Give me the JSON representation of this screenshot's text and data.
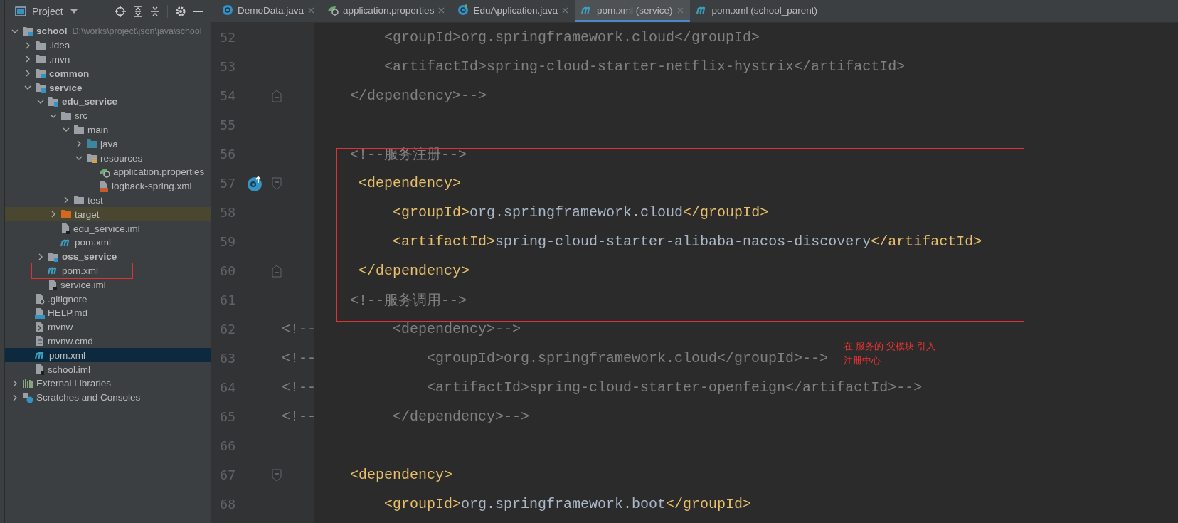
{
  "sidebar": {
    "title": "Project",
    "tree": [
      {
        "label": "school",
        "kind": "module",
        "bold": true,
        "path": "D:\\works\\project\\json\\java\\school",
        "expanded": true,
        "selected": false,
        "boxed": false,
        "children": [
          {
            "label": ".idea",
            "kind": "folder",
            "bold": false,
            "expanded": false,
            "selected": false,
            "boxed": false
          },
          {
            "label": ".mvn",
            "kind": "folder",
            "bold": false,
            "expanded": false,
            "selected": false,
            "boxed": false
          },
          {
            "label": "common",
            "kind": "module",
            "bold": true,
            "expanded": false,
            "selected": false,
            "boxed": false
          },
          {
            "label": "service",
            "kind": "module",
            "bold": true,
            "expanded": true,
            "selected": false,
            "boxed": false,
            "children": [
              {
                "label": "edu_service",
                "kind": "module",
                "bold": true,
                "expanded": true,
                "selected": false,
                "boxed": false,
                "children": [
                  {
                    "label": "src",
                    "kind": "folder",
                    "bold": false,
                    "expanded": true,
                    "selected": false,
                    "boxed": false,
                    "children": [
                      {
                        "label": "main",
                        "kind": "folder",
                        "bold": false,
                        "expanded": true,
                        "selected": false,
                        "boxed": false,
                        "children": [
                          {
                            "label": "java",
                            "kind": "source",
                            "bold": false,
                            "expanded": false,
                            "selected": false,
                            "boxed": false
                          },
                          {
                            "label": "resources",
                            "kind": "resources",
                            "bold": false,
                            "expanded": true,
                            "selected": false,
                            "boxed": false,
                            "children": [
                              {
                                "label": "application.properties",
                                "kind": "spring",
                                "bold": false,
                                "selected": false,
                                "boxed": false
                              },
                              {
                                "label": "logback-spring.xml",
                                "kind": "xml",
                                "bold": false,
                                "selected": false,
                                "boxed": false
                              }
                            ]
                          }
                        ]
                      },
                      {
                        "label": "test",
                        "kind": "folder",
                        "bold": false,
                        "expanded": false,
                        "selected": false,
                        "boxed": false
                      }
                    ]
                  },
                  {
                    "label": "target",
                    "kind": "excluded",
                    "bold": false,
                    "expanded": false,
                    "selected": false,
                    "boxed": false
                  },
                  {
                    "label": "edu_service.iml",
                    "kind": "iml",
                    "bold": false,
                    "selected": false,
                    "boxed": false
                  },
                  {
                    "label": "pom.xml",
                    "kind": "maven",
                    "bold": false,
                    "selected": false,
                    "boxed": false
                  }
                ]
              },
              {
                "label": "oss_service",
                "kind": "module",
                "bold": true,
                "expanded": false,
                "selected": false,
                "boxed": false
              },
              {
                "label": "pom.xml",
                "kind": "maven",
                "bold": false,
                "selected": false,
                "boxed": true
              },
              {
                "label": "service.iml",
                "kind": "iml",
                "bold": false,
                "selected": false,
                "boxed": false
              }
            ]
          },
          {
            "label": ".gitignore",
            "kind": "ignore",
            "bold": false,
            "selected": false,
            "boxed": false
          },
          {
            "label": "HELP.md",
            "kind": "md",
            "bold": false,
            "selected": false,
            "boxed": false
          },
          {
            "label": "mvnw",
            "kind": "script",
            "bold": false,
            "selected": false,
            "boxed": false
          },
          {
            "label": "mvnw.cmd",
            "kind": "text",
            "bold": false,
            "selected": false,
            "boxed": false
          },
          {
            "label": "pom.xml",
            "kind": "maven",
            "bold": false,
            "selected": true,
            "boxed": false
          },
          {
            "label": "school.iml",
            "kind": "iml",
            "bold": false,
            "selected": false,
            "boxed": false
          }
        ]
      },
      {
        "label": "External Libraries",
        "kind": "libs",
        "bold": false,
        "expanded": false,
        "selected": false,
        "boxed": false
      },
      {
        "label": "Scratches and Consoles",
        "kind": "scratches",
        "bold": false,
        "expanded": false,
        "selected": false,
        "boxed": false
      }
    ]
  },
  "tabs": [
    {
      "label": "DemoData.java",
      "kind": "java",
      "selected": false,
      "closable": true
    },
    {
      "label": "application.properties",
      "kind": "spring",
      "selected": false,
      "closable": true
    },
    {
      "label": "EduApplication.java",
      "kind": "boot",
      "selected": false,
      "closable": true
    },
    {
      "label": "pom.xml (service)",
      "kind": "maven",
      "selected": true,
      "closable": true
    },
    {
      "label": "pom.xml (school_parent)",
      "kind": "maven",
      "selected": false,
      "closable": false
    }
  ],
  "editor": {
    "lines": [
      {
        "number": "52",
        "boxed": false,
        "fold_start": false,
        "fold_end": false,
        "implemented": false,
        "segments": [
          {
            "kind": "comment",
            "text": "            <groupId>org.springframework.cloud</groupId>"
          }
        ]
      },
      {
        "number": "53",
        "boxed": false,
        "fold_start": false,
        "fold_end": false,
        "implemented": false,
        "segments": [
          {
            "kind": "comment",
            "text": "            <artifactId>spring-cloud-starter-netflix-hystrix</artifactId>"
          }
        ]
      },
      {
        "number": "54",
        "boxed": false,
        "fold_start": false,
        "fold_end": true,
        "implemented": false,
        "segments": [
          {
            "kind": "comment",
            "text": "        </dependency>-->"
          }
        ]
      },
      {
        "number": "55",
        "boxed": false,
        "fold_start": false,
        "fold_end": false,
        "implemented": false
      },
      {
        "number": "56",
        "boxed": true,
        "fold_start": false,
        "fold_end": false,
        "implemented": false,
        "segments": [
          {
            "kind": "comment",
            "text": "        <!--服务注册-->"
          }
        ]
      },
      {
        "number": "57",
        "boxed": true,
        "fold_start": true,
        "fold_end": false,
        "implemented": true,
        "segments": [
          {
            "kind": "tag",
            "text": "         <dependency>"
          }
        ]
      },
      {
        "number": "58",
        "boxed": true,
        "fold_start": false,
        "fold_end": false,
        "implemented": false,
        "segments": [
          {
            "kind": "tag",
            "text": "             <groupId>"
          },
          {
            "kind": "text",
            "text": "org.springframework.cloud"
          },
          {
            "kind": "tag",
            "text": "</groupId>"
          }
        ]
      },
      {
        "number": "59",
        "boxed": true,
        "fold_start": false,
        "fold_end": false,
        "implemented": false,
        "segments": [
          {
            "kind": "tag",
            "text": "             <artifactId>"
          },
          {
            "kind": "text",
            "text": "spring-cloud-starter-alibaba-nacos-discovery"
          },
          {
            "kind": "tag",
            "text": "</artifactId>"
          }
        ]
      },
      {
        "number": "60",
        "boxed": true,
        "fold_start": false,
        "fold_end": true,
        "implemented": false,
        "segments": [
          {
            "kind": "tag",
            "text": "         </dependency>"
          }
        ]
      },
      {
        "number": "61",
        "boxed": true,
        "fold_start": false,
        "fold_end": false,
        "implemented": false,
        "segments": [
          {
            "kind": "comment",
            "text": "        <!--服务调用-->"
          }
        ]
      },
      {
        "number": "62",
        "boxed": false,
        "fold_start": false,
        "fold_end": false,
        "implemented": false,
        "segments": [
          {
            "kind": "comment",
            "text": "<!--         <dependency>-->"
          }
        ]
      },
      {
        "number": "63",
        "boxed": false,
        "fold_start": false,
        "fold_end": false,
        "implemented": false,
        "segments": [
          {
            "kind": "comment",
            "text": "<!--             <groupId>org.springframework.cloud</groupId>-->"
          }
        ]
      },
      {
        "number": "64",
        "boxed": false,
        "fold_start": false,
        "fold_end": false,
        "implemented": false,
        "segments": [
          {
            "kind": "comment",
            "text": "<!--             <artifactId>spring-cloud-starter-openfeign</artifactId>-->"
          }
        ]
      },
      {
        "number": "65",
        "boxed": false,
        "fold_start": false,
        "fold_end": false,
        "implemented": false,
        "segments": [
          {
            "kind": "comment",
            "text": "<!--         </dependency>-->"
          }
        ]
      },
      {
        "number": "66",
        "boxed": false,
        "fold_start": false,
        "fold_end": false,
        "implemented": false
      },
      {
        "number": "67",
        "boxed": false,
        "fold_start": true,
        "fold_end": false,
        "implemented": false,
        "segments": [
          {
            "kind": "tag",
            "text": "        <dependency>"
          }
        ]
      },
      {
        "number": "68",
        "boxed": false,
        "fold_start": false,
        "fold_end": false,
        "implemented": false,
        "segments": [
          {
            "kind": "tag",
            "text": "            <groupId>"
          },
          {
            "kind": "text",
            "text": "org.springframework.boot"
          },
          {
            "kind": "tag",
            "text": "</groupId>"
          }
        ]
      }
    ],
    "note": [
      "在 服务的 父模块 引入",
      "注册中心"
    ]
  }
}
